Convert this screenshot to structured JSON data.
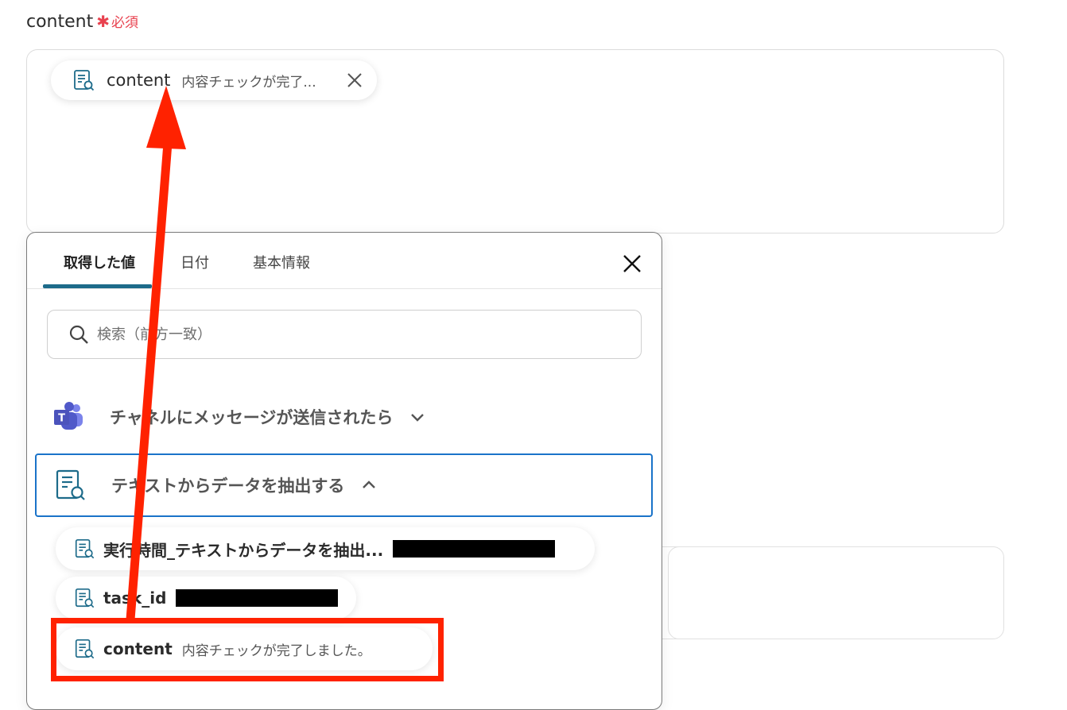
{
  "field": {
    "label": "content",
    "required_star": "✱",
    "required_text": "必須"
  },
  "selected_chip": {
    "name": "content",
    "value": "内容チェックが完了..."
  },
  "panel": {
    "tabs": [
      {
        "label": "取得した値",
        "active": true
      },
      {
        "label": "日付",
        "active": false
      },
      {
        "label": "基本情報",
        "active": false
      }
    ],
    "search_placeholder": "検索（前方一致）",
    "sections": [
      {
        "title": "チャネルにメッセージが送信されたら",
        "expanded": false,
        "icon": "teams-icon"
      },
      {
        "title": "テキストからデータを抽出する",
        "expanded": true,
        "icon": "extract-doc-icon"
      }
    ],
    "items": [
      {
        "name": "実行時間_テキストからデータを抽出...",
        "value": ""
      },
      {
        "name": "task_id",
        "value": ""
      },
      {
        "name": "content",
        "value": "内容チェックが完了しました。"
      }
    ]
  },
  "colors": {
    "accent": "#1d6b8a",
    "required": "#e8424f",
    "highlight": "#ff2200",
    "section_border": "#1a73c9"
  }
}
